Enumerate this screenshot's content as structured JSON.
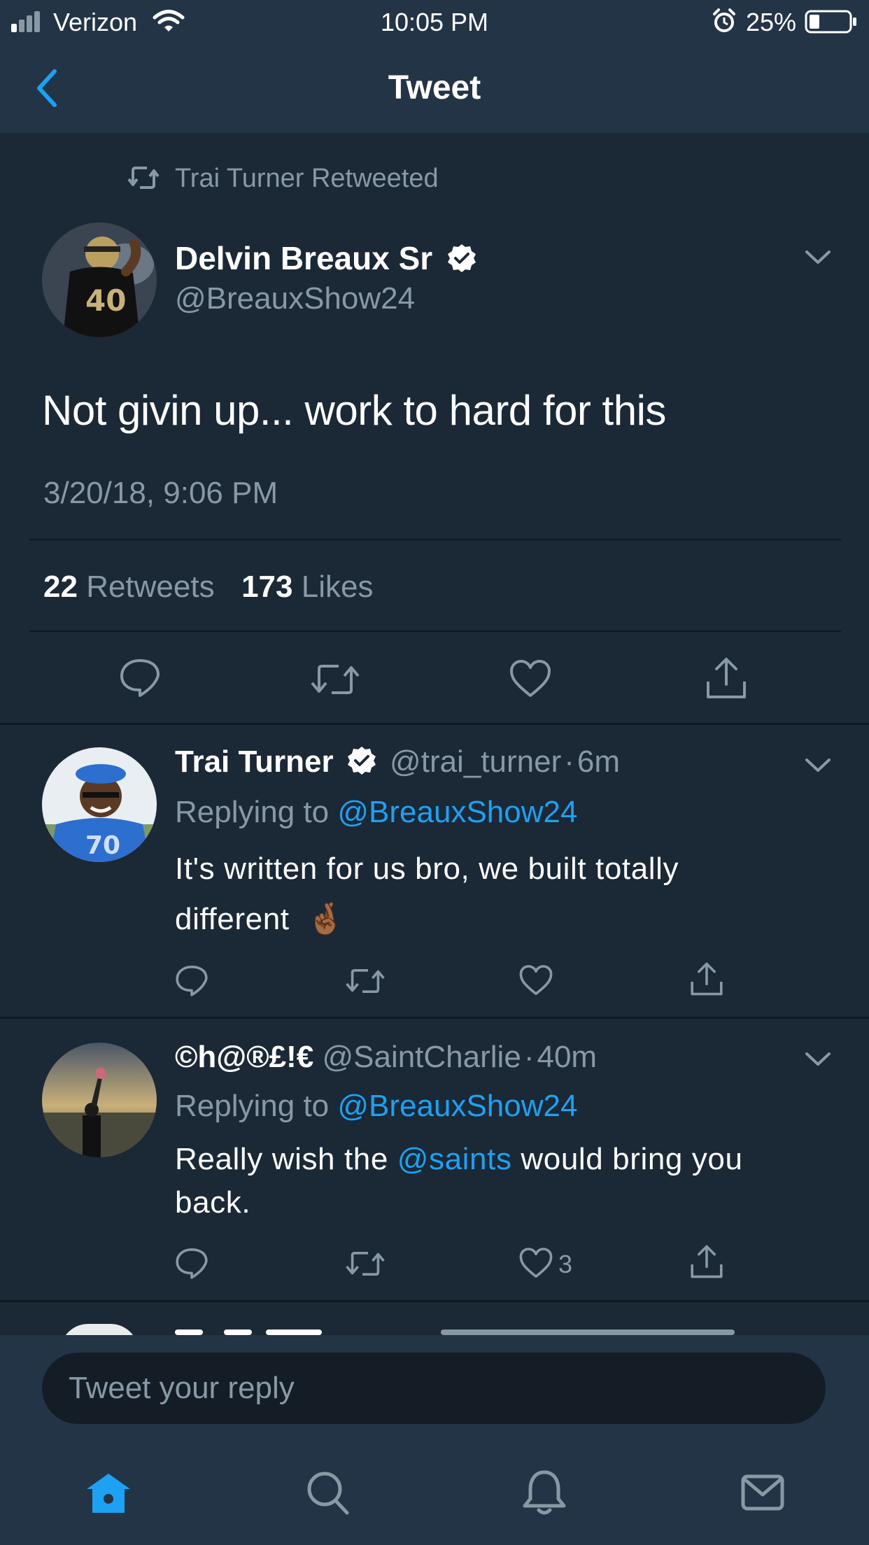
{
  "status_bar": {
    "carrier": "Verizon",
    "time": "10:05 PM",
    "battery": "25%",
    "battery_level": 0.25
  },
  "nav": {
    "title": "Tweet",
    "back_icon": "chevron-left-icon"
  },
  "retweet_context": {
    "text": "Trai Turner Retweeted",
    "icon": "retweet-icon"
  },
  "main_tweet": {
    "name": "Delvin Breaux Sr",
    "verified": true,
    "handle": "@BreauxShow24",
    "text": "Not givin up... work to hard for this",
    "timestamp": "3/20/18, 9:06 PM",
    "retweets_count": "22",
    "retweets_label": "Retweets",
    "likes_count": "173",
    "likes_label": "Likes"
  },
  "replies": [
    {
      "name": "Trai Turner",
      "verified": true,
      "handle": "@trai_turner",
      "sep": "·",
      "time": "6m",
      "replying_prefix": "Replying to",
      "replying_to": "@BreauxShow24",
      "text_line1": "It's written for us bro, we built totally",
      "text_line2": "different",
      "emoji": "🤞🏾",
      "likes": ""
    },
    {
      "name": "©h@®£!€",
      "verified": false,
      "handle": "@SaintCharlie",
      "sep": "·",
      "time": "40m",
      "replying_prefix": "Replying to",
      "replying_to": "@BreauxShow24",
      "text_before": "Really wish the",
      "text_mention": "@saints",
      "text_after": "would bring you",
      "text_line2": "back.",
      "likes": "3"
    }
  ],
  "reply_bar": {
    "placeholder": "Tweet your reply"
  },
  "tab_bar": {
    "items": [
      "home-icon",
      "search-icon",
      "bell-icon",
      "mail-icon"
    ],
    "active": "home-icon"
  },
  "colors": {
    "background": "#1b2836",
    "bar": "#243447",
    "accent": "#1da1f2",
    "muted": "#8899a6"
  }
}
